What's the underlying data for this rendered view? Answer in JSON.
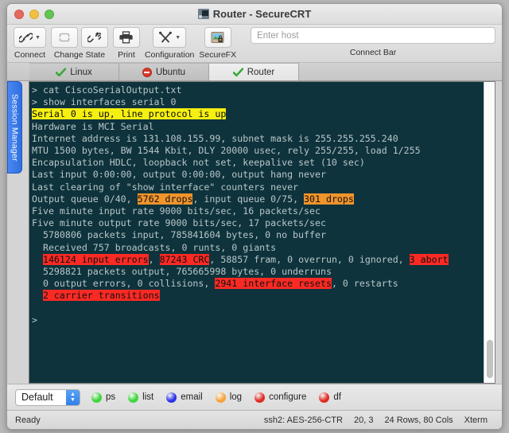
{
  "window": {
    "title": "Router - SecureCRT",
    "app_icon": "terminal-icon"
  },
  "toolbar": {
    "items": [
      {
        "label": "Connect",
        "icon": "link-icon",
        "has_chevron": true
      },
      {
        "label": "Change State",
        "icon": "repeat-icon",
        "icon2": "broken-link-icon",
        "has_chevron": false
      },
      {
        "label": "Print",
        "icon": "printer-icon",
        "has_chevron": false
      },
      {
        "label": "Configuration",
        "icon": "tools-icon",
        "has_chevron": true
      },
      {
        "label": "SecureFX",
        "icon": "securefx-icon",
        "has_chevron": false
      }
    ],
    "host_placeholder": "Enter host",
    "host_value": "",
    "connect_bar_label": "Connect Bar"
  },
  "sidebar": {
    "session_manager_label": "Session Manager"
  },
  "tabs": [
    {
      "label": "Linux",
      "status_icon": "green-check-icon",
      "active": false
    },
    {
      "label": "Ubuntu",
      "status_icon": "red-stop-icon",
      "active": false
    },
    {
      "label": "Router",
      "status_icon": "green-check-icon",
      "active": true
    }
  ],
  "terminal": {
    "colors": {
      "background": "#0e333c",
      "text": "#b9c6c9",
      "highlight_yellow": "#f5ef12",
      "highlight_orange": "#f0942c",
      "highlight_red": "#fb2a24"
    },
    "lines": [
      [
        {
          "t": "> cat CiscoSerialOutput.txt"
        }
      ],
      [
        {
          "t": "> show interfaces serial 0"
        }
      ],
      [
        {
          "t": "Serial 0 is up, line protocol is up",
          "h": "y"
        }
      ],
      [
        {
          "t": "Hardware is MCI Serial"
        }
      ],
      [
        {
          "t": "Internet address is 131.108.155.99, subnet mask is 255.255.255.240"
        }
      ],
      [
        {
          "t": "MTU 1500 bytes, BW 1544 Kbit, DLY 20000 usec, rely 255/255, load 1/255"
        }
      ],
      [
        {
          "t": "Encapsulation HDLC, loopback not set, keepalive set (10 sec)"
        }
      ],
      [
        {
          "t": "Last input 0:00:00, output 0:00:00, output hang never"
        }
      ],
      [
        {
          "t": "Last clearing of \"show interface\" counters never"
        }
      ],
      [
        {
          "t": "Output queue 0/40, "
        },
        {
          "t": "5762 drops",
          "h": "o"
        },
        {
          "t": ", input queue 0/75, "
        },
        {
          "t": "301 drops",
          "h": "o"
        }
      ],
      [
        {
          "t": "Five minute input rate 9000 bits/sec, 16 packets/sec"
        }
      ],
      [
        {
          "t": "Five minute output rate 9000 bits/sec, 17 packets/sec"
        }
      ],
      [
        {
          "t": "  5780806 packets input, 785841604 bytes, 0 no buffer"
        }
      ],
      [
        {
          "t": "  Received 757 broadcasts, 0 runts, 0 giants"
        }
      ],
      [
        {
          "t": "  "
        },
        {
          "t": "146124 input errors",
          "h": "r"
        },
        {
          "t": ", "
        },
        {
          "t": "87243 CRC",
          "h": "r"
        },
        {
          "t": ", 58857 fram, 0 overrun, 0 ignored, "
        },
        {
          "t": "3 abort",
          "h": "r"
        }
      ],
      [
        {
          "t": "  5298821 packets output, 765665998 bytes, 0 underruns"
        }
      ],
      [
        {
          "t": "  0 output errors, 0 collisions, "
        },
        {
          "t": "2941 interface resets",
          "h": "r"
        },
        {
          "t": ", 0 restarts"
        }
      ],
      [
        {
          "t": "  "
        },
        {
          "t": "2 carrier transitions",
          "h": "r"
        }
      ],
      [
        {
          "t": ""
        }
      ],
      [
        {
          "t": ">"
        }
      ]
    ]
  },
  "button_bar": {
    "session_select": {
      "value": "Default"
    },
    "buttons": [
      {
        "label": "ps",
        "color": "#3dd63b"
      },
      {
        "label": "list",
        "color": "#3dd63b"
      },
      {
        "label": "email",
        "color": "#2c32e8"
      },
      {
        "label": "log",
        "color": "#f5a33c"
      },
      {
        "label": "configure",
        "color": "#e02b25"
      },
      {
        "label": "df",
        "color": "#e02b25"
      }
    ]
  },
  "status_bar": {
    "ready": "Ready",
    "protocol": "ssh2: AES-256-CTR",
    "cursor": "20,  3",
    "dimensions": "24 Rows, 80 Cols",
    "emulation": "Xterm"
  }
}
